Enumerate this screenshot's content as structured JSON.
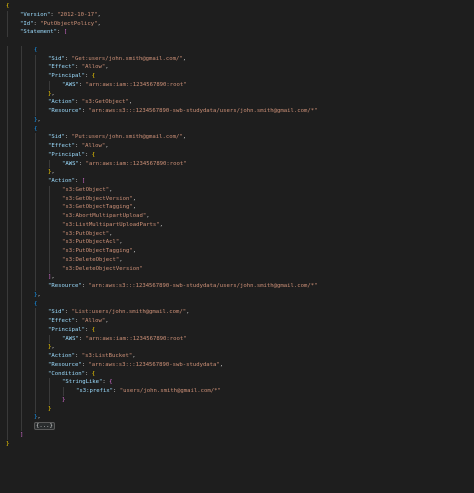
{
  "theme": {
    "background": "#1e1e1e",
    "key": "#9cdcfe",
    "string": "#ce9178",
    "punctuation": "#d4d4d4",
    "bracket_1": "#ffd700",
    "bracket_2": "#da70d6",
    "bracket_3": "#179fff"
  },
  "lines": [
    {
      "indent": 0,
      "tokens": [
        {
          "c": "b1",
          "t": "{"
        }
      ]
    },
    {
      "indent": 1,
      "tokens": [
        {
          "c": "key",
          "t": "\"Version\""
        },
        {
          "c": "pun",
          "t": ": "
        },
        {
          "c": "str",
          "t": "\"2012-10-17\""
        },
        {
          "c": "pun",
          "t": ","
        }
      ]
    },
    {
      "indent": 1,
      "tokens": [
        {
          "c": "key",
          "t": "\"Id\""
        },
        {
          "c": "pun",
          "t": ": "
        },
        {
          "c": "str",
          "t": "\"PutObjectPolicy\""
        },
        {
          "c": "pun",
          "t": ","
        }
      ]
    },
    {
      "indent": 1,
      "tokens": [
        {
          "c": "key",
          "t": "\"Statement\""
        },
        {
          "c": "pun",
          "t": ": "
        },
        {
          "c": "b2",
          "t": "["
        }
      ]
    },
    {
      "indent": 0,
      "tokens": []
    },
    {
      "indent": 2,
      "tokens": [
        {
          "c": "b3",
          "t": "{"
        }
      ]
    },
    {
      "indent": 3,
      "tokens": [
        {
          "c": "key",
          "t": "\"Sid\""
        },
        {
          "c": "pun",
          "t": ": "
        },
        {
          "c": "str",
          "t": "\"Get:users/john.smith@gmail.com/\""
        },
        {
          "c": "pun",
          "t": ","
        }
      ]
    },
    {
      "indent": 3,
      "tokens": [
        {
          "c": "key",
          "t": "\"Effect\""
        },
        {
          "c": "pun",
          "t": ": "
        },
        {
          "c": "str",
          "t": "\"Allow\""
        },
        {
          "c": "pun",
          "t": ","
        }
      ]
    },
    {
      "indent": 3,
      "tokens": [
        {
          "c": "key",
          "t": "\"Principal\""
        },
        {
          "c": "pun",
          "t": ": "
        },
        {
          "c": "b1",
          "t": "{"
        }
      ]
    },
    {
      "indent": 4,
      "tokens": [
        {
          "c": "key",
          "t": "\"AWS\""
        },
        {
          "c": "pun",
          "t": ": "
        },
        {
          "c": "str",
          "t": "\"arn:aws:iam::1234567890:root\""
        }
      ]
    },
    {
      "indent": 3,
      "tokens": [
        {
          "c": "b1",
          "t": "}"
        },
        {
          "c": "pun",
          "t": ","
        }
      ]
    },
    {
      "indent": 3,
      "tokens": [
        {
          "c": "key",
          "t": "\"Action\""
        },
        {
          "c": "pun",
          "t": ": "
        },
        {
          "c": "str",
          "t": "\"s3:GetObject\""
        },
        {
          "c": "pun",
          "t": ","
        }
      ]
    },
    {
      "indent": 3,
      "tokens": [
        {
          "c": "key",
          "t": "\"Resource\""
        },
        {
          "c": "pun",
          "t": ": "
        },
        {
          "c": "str",
          "t": "\"arn:aws:s3:::1234567890-swb-studydata/users/john.smith@gmail.com/*\""
        }
      ]
    },
    {
      "indent": 2,
      "tokens": [
        {
          "c": "b3",
          "t": "}"
        },
        {
          "c": "pun",
          "t": ","
        }
      ]
    },
    {
      "indent": 2,
      "tokens": [
        {
          "c": "b3",
          "t": "{"
        }
      ]
    },
    {
      "indent": 3,
      "tokens": [
        {
          "c": "key",
          "t": "\"Sid\""
        },
        {
          "c": "pun",
          "t": ": "
        },
        {
          "c": "str",
          "t": "\"Put:users/john.smith@gmail.com/\""
        },
        {
          "c": "pun",
          "t": ","
        }
      ]
    },
    {
      "indent": 3,
      "tokens": [
        {
          "c": "key",
          "t": "\"Effect\""
        },
        {
          "c": "pun",
          "t": ": "
        },
        {
          "c": "str",
          "t": "\"Allow\""
        },
        {
          "c": "pun",
          "t": ","
        }
      ]
    },
    {
      "indent": 3,
      "tokens": [
        {
          "c": "key",
          "t": "\"Principal\""
        },
        {
          "c": "pun",
          "t": ": "
        },
        {
          "c": "b1",
          "t": "{"
        }
      ]
    },
    {
      "indent": 4,
      "tokens": [
        {
          "c": "key",
          "t": "\"AWS\""
        },
        {
          "c": "pun",
          "t": ": "
        },
        {
          "c": "str",
          "t": "\"arn:aws:iam::1234567890:root\""
        }
      ]
    },
    {
      "indent": 3,
      "tokens": [
        {
          "c": "b1",
          "t": "}"
        },
        {
          "c": "pun",
          "t": ","
        }
      ]
    },
    {
      "indent": 3,
      "tokens": [
        {
          "c": "key",
          "t": "\"Action\""
        },
        {
          "c": "pun",
          "t": ": "
        },
        {
          "c": "b2",
          "t": "["
        }
      ]
    },
    {
      "indent": 4,
      "tokens": [
        {
          "c": "str",
          "t": "\"s3:GetObject\""
        },
        {
          "c": "pun",
          "t": ","
        }
      ]
    },
    {
      "indent": 4,
      "tokens": [
        {
          "c": "str",
          "t": "\"s3:GetObjectVersion\""
        },
        {
          "c": "pun",
          "t": ","
        }
      ]
    },
    {
      "indent": 4,
      "tokens": [
        {
          "c": "str",
          "t": "\"s3:GetObjectTagging\""
        },
        {
          "c": "pun",
          "t": ","
        }
      ]
    },
    {
      "indent": 4,
      "tokens": [
        {
          "c": "str",
          "t": "\"s3:AbortMultipartUpload\""
        },
        {
          "c": "pun",
          "t": ","
        }
      ]
    },
    {
      "indent": 4,
      "tokens": [
        {
          "c": "str",
          "t": "\"s3:ListMultipartUploadParts\""
        },
        {
          "c": "pun",
          "t": ","
        }
      ]
    },
    {
      "indent": 4,
      "tokens": [
        {
          "c": "str",
          "t": "\"s3:PutObject\""
        },
        {
          "c": "pun",
          "t": ","
        }
      ]
    },
    {
      "indent": 4,
      "tokens": [
        {
          "c": "str",
          "t": "\"s3:PutObjectAcl\""
        },
        {
          "c": "pun",
          "t": ","
        }
      ]
    },
    {
      "indent": 4,
      "tokens": [
        {
          "c": "str",
          "t": "\"s3:PutObjectTagging\""
        },
        {
          "c": "pun",
          "t": ","
        }
      ]
    },
    {
      "indent": 4,
      "tokens": [
        {
          "c": "str",
          "t": "\"s3:DeleteObject\""
        },
        {
          "c": "pun",
          "t": ","
        }
      ]
    },
    {
      "indent": 4,
      "tokens": [
        {
          "c": "str",
          "t": "\"s3:DeleteObjectVersion\""
        }
      ]
    },
    {
      "indent": 3,
      "tokens": [
        {
          "c": "b2",
          "t": "]"
        },
        {
          "c": "pun",
          "t": ","
        }
      ]
    },
    {
      "indent": 3,
      "tokens": [
        {
          "c": "key",
          "t": "\"Resource\""
        },
        {
          "c": "pun",
          "t": ": "
        },
        {
          "c": "str",
          "t": "\"arn:aws:s3:::1234567890-swb-studydata/users/john.smith@gmail.com/*\""
        }
      ]
    },
    {
      "indent": 2,
      "tokens": [
        {
          "c": "b3",
          "t": "}"
        },
        {
          "c": "pun",
          "t": ","
        }
      ]
    },
    {
      "indent": 2,
      "tokens": [
        {
          "c": "b3",
          "t": "{"
        }
      ]
    },
    {
      "indent": 3,
      "tokens": [
        {
          "c": "key",
          "t": "\"Sid\""
        },
        {
          "c": "pun",
          "t": ": "
        },
        {
          "c": "str",
          "t": "\"List:users/john.smith@gmail.com/\""
        },
        {
          "c": "pun",
          "t": ","
        }
      ]
    },
    {
      "indent": 3,
      "tokens": [
        {
          "c": "key",
          "t": "\"Effect\""
        },
        {
          "c": "pun",
          "t": ": "
        },
        {
          "c": "str",
          "t": "\"Allow\""
        },
        {
          "c": "pun",
          "t": ","
        }
      ]
    },
    {
      "indent": 3,
      "tokens": [
        {
          "c": "key",
          "t": "\"Principal\""
        },
        {
          "c": "pun",
          "t": ": "
        },
        {
          "c": "b1",
          "t": "{"
        }
      ]
    },
    {
      "indent": 4,
      "tokens": [
        {
          "c": "key",
          "t": "\"AWS\""
        },
        {
          "c": "pun",
          "t": ": "
        },
        {
          "c": "str",
          "t": "\"arn:aws:iam::1234567890:root\""
        }
      ]
    },
    {
      "indent": 3,
      "tokens": [
        {
          "c": "b1",
          "t": "}"
        },
        {
          "c": "pun",
          "t": ","
        }
      ]
    },
    {
      "indent": 3,
      "tokens": [
        {
          "c": "key",
          "t": "\"Action\""
        },
        {
          "c": "pun",
          "t": ": "
        },
        {
          "c": "str",
          "t": "\"s3:ListBucket\""
        },
        {
          "c": "pun",
          "t": ","
        }
      ]
    },
    {
      "indent": 3,
      "tokens": [
        {
          "c": "key",
          "t": "\"Resource\""
        },
        {
          "c": "pun",
          "t": ": "
        },
        {
          "c": "str",
          "t": "\"arn:aws:s3:::1234567890-swb-studydata\""
        },
        {
          "c": "pun",
          "t": ","
        }
      ]
    },
    {
      "indent": 3,
      "tokens": [
        {
          "c": "key",
          "t": "\"Condition\""
        },
        {
          "c": "pun",
          "t": ": "
        },
        {
          "c": "b1",
          "t": "{"
        }
      ]
    },
    {
      "indent": 4,
      "tokens": [
        {
          "c": "key",
          "t": "\"StringLike\""
        },
        {
          "c": "pun",
          "t": ": "
        },
        {
          "c": "b2",
          "t": "{"
        }
      ]
    },
    {
      "indent": 5,
      "tokens": [
        {
          "c": "key",
          "t": "\"s3:prefix\""
        },
        {
          "c": "pun",
          "t": ": "
        },
        {
          "c": "str",
          "t": "\"users/john.smith@gmail.com/*\""
        }
      ]
    },
    {
      "indent": 4,
      "tokens": [
        {
          "c": "b2",
          "t": "}"
        }
      ]
    },
    {
      "indent": 3,
      "tokens": [
        {
          "c": "b1",
          "t": "}"
        }
      ]
    },
    {
      "indent": 2,
      "tokens": [
        {
          "c": "b3",
          "t": "}"
        },
        {
          "c": "pun",
          "t": ","
        }
      ]
    },
    {
      "indent": 2,
      "tokens": [
        {
          "c": "fold",
          "t": "{...}"
        }
      ]
    },
    {
      "indent": 1,
      "tokens": [
        {
          "c": "b2",
          "t": "]"
        }
      ]
    },
    {
      "indent": 0,
      "tokens": [
        {
          "c": "b1",
          "t": "}"
        }
      ]
    }
  ]
}
